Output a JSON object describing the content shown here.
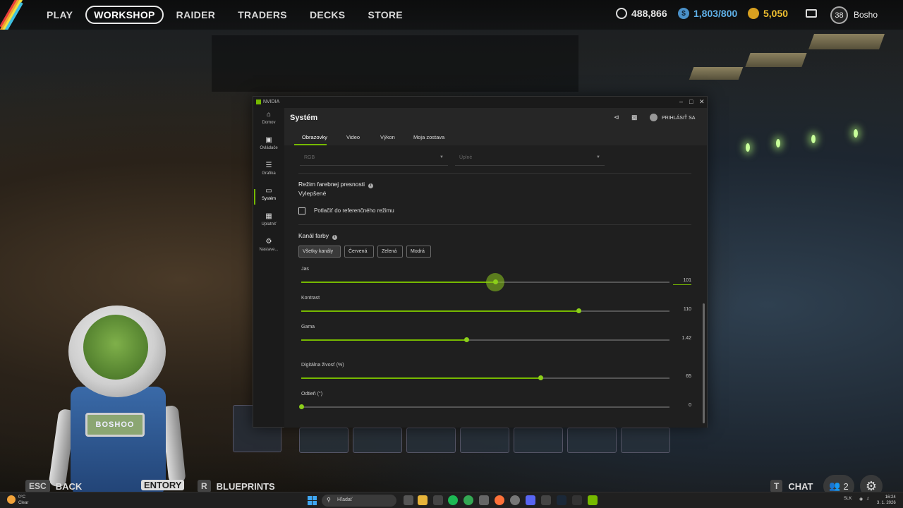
{
  "game": {
    "nav": [
      "PLAY",
      "WORKSHOP",
      "RAIDER",
      "TRADERS",
      "DECKS",
      "STORE"
    ],
    "active_nav": "WORKSHOP",
    "currencies": {
      "coins": "488,866",
      "storage": "1,803/800",
      "raider_tokens": "5,050"
    },
    "level": "38",
    "username": "Bosho",
    "robot_nameplate": "BOSHOO",
    "hints": {
      "back_key": "ESC",
      "back_label": "BACK",
      "inventory_label": "ENTORY",
      "blueprints_key": "R",
      "blueprints_label": "BLUEPRINTS",
      "chat_key": "T",
      "chat_label": "CHAT"
    },
    "party_count": "2"
  },
  "nvidia": {
    "app_title": "NVIDIA",
    "sidebar": [
      {
        "label": "Domov",
        "icon": "home-icon"
      },
      {
        "label": "Ovládače",
        "icon": "driver-icon"
      },
      {
        "label": "Grafika",
        "icon": "sliders-icon"
      },
      {
        "label": "Systém",
        "icon": "monitor-icon"
      },
      {
        "label": "Uplatniť",
        "icon": "gift-icon"
      },
      {
        "label": "Nastave...",
        "icon": "gear-icon"
      }
    ],
    "active_sidebar": "Systém",
    "header_title": "Systém",
    "login_label": "PRIHLÁSIŤ SA",
    "tabs": [
      "Obrazovky",
      "Video",
      "Výkon",
      "Moja zostava"
    ],
    "active_tab": "Obrazovky",
    "dropdowns": [
      {
        "value": "RGB"
      },
      {
        "value": "Úplné"
      }
    ],
    "color_accuracy": {
      "title": "Režim farebnej presnosti",
      "value": "Vylepšené",
      "checkbox_label": "Potlačiť do referenčného režimu",
      "checked": false
    },
    "color_channel": {
      "title": "Kanál farby",
      "buttons": [
        "Všetky kanály",
        "Červená",
        "Zelená",
        "Modrá"
      ],
      "active": "Všetky kanály"
    },
    "sliders": [
      {
        "label": "Jas",
        "value": "101",
        "fraction": 0.526,
        "focused": true
      },
      {
        "label": "Kontrast",
        "value": "110",
        "fraction": 0.752,
        "focused": false
      },
      {
        "label": "Gama",
        "value": "1.42",
        "fraction": 0.448,
        "focused": false
      },
      {
        "label": "Digitálna živosť (%)",
        "value": "65",
        "fraction": 0.65,
        "focused": false
      },
      {
        "label": "Odtieň (°)",
        "value": "0",
        "fraction": 0.0,
        "focused": false
      }
    ],
    "accent_color": "#76b900"
  },
  "taskbar": {
    "weather_temp": "0°C",
    "weather_desc": "Clear",
    "search_placeholder": "Hľadať",
    "language": "SLK",
    "time": "16:24",
    "date": "3. 1. 2026"
  }
}
